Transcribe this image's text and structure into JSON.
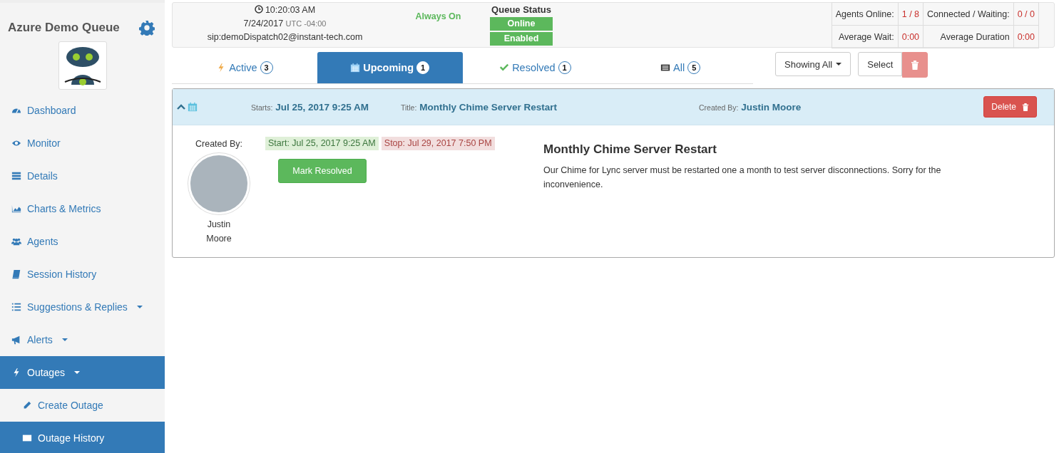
{
  "sidebar": {
    "title": "Azure Demo Queue",
    "items": [
      {
        "label": "Dashboard",
        "dropdown": false,
        "selected": false
      },
      {
        "label": "Monitor",
        "dropdown": false,
        "selected": false
      },
      {
        "label": "Details",
        "dropdown": false,
        "selected": false
      },
      {
        "label": "Charts & Metrics",
        "dropdown": false,
        "selected": false
      },
      {
        "label": "Agents",
        "dropdown": false,
        "selected": false
      },
      {
        "label": "Session History",
        "dropdown": false,
        "selected": false
      },
      {
        "label": "Suggestions & Replies",
        "dropdown": true,
        "selected": false
      },
      {
        "label": "Alerts",
        "dropdown": true,
        "selected": false
      },
      {
        "label": "Outages",
        "dropdown": true,
        "selected": true,
        "children": [
          {
            "label": "Create Outage",
            "dropdown": false,
            "selected": false
          },
          {
            "label": "Outage History",
            "dropdown": false,
            "selected": true
          }
        ]
      }
    ]
  },
  "header": {
    "time": "10:20:03 AM",
    "date": "7/24/2017",
    "timezone": "UTC -04:00",
    "address": "sip:demoDispatch02@instant-tech.com",
    "mode": "Always On",
    "queue_status": {
      "label": "Queue Status",
      "badges": [
        "Online",
        "Enabled"
      ]
    },
    "stats": [
      {
        "label": "Agents Online:",
        "value": "1 / 8"
      },
      {
        "label": "Connected / Waiting:",
        "value": "0 / 0"
      },
      {
        "label": "Average Wait:",
        "value": "0:00"
      },
      {
        "label": "Average Duration",
        "value": "0:00"
      }
    ]
  },
  "tabs": [
    {
      "label": "Active",
      "count": "3",
      "selected": false
    },
    {
      "label": "Upcoming",
      "count": "1",
      "selected": true
    },
    {
      "label": "Resolved",
      "count": "1",
      "selected": false
    },
    {
      "label": "All",
      "count": "5",
      "selected": false
    }
  ],
  "toolbar": {
    "filter": "Showing All",
    "select": "Select"
  },
  "outage": {
    "expanded": true,
    "starts_label": "Starts:",
    "starts": "Jul 25, 2017 9:25 AM",
    "title_label": "Title:",
    "title": "Monthly Chime Server Restart",
    "created_label": "Created By:",
    "created_by": "Justin Moore",
    "delete": "Delete",
    "body": {
      "created_label": "Created By:",
      "author": "Justin Moore",
      "start": "Start: Jul 25, 2017 9:25 AM",
      "stop": "Stop: Jul 29, 2017 7:50 PM",
      "action": "Mark Resolved",
      "heading": "Monthly Chime Server Restart",
      "description": "Our Chime for Lync server must be restarted one a month to test server disconnections. Sorry for the inconvenience."
    }
  }
}
